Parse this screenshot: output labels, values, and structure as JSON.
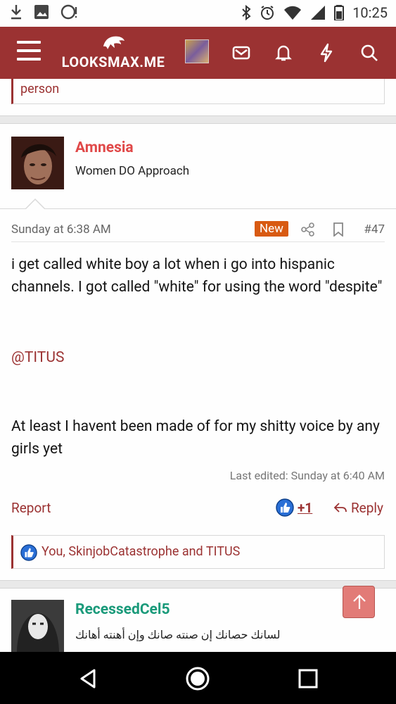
{
  "status_bar": {
    "time": "10:25",
    "left_icons": [
      "download-icon",
      "image-icon",
      "alert-cloud-icon"
    ],
    "right_icons": [
      "bluetooth-icon",
      "alarm-icon",
      "wifi-icon",
      "signal-icon",
      "battery-icon"
    ]
  },
  "app_bar": {
    "site_name": "LOOKSMAX.ME",
    "icons": [
      "menu-icon",
      "avatar",
      "inbox-icon",
      "bell-icon",
      "lightning-icon",
      "search-icon"
    ],
    "color": "#9b3232"
  },
  "previous_post": {
    "reaction_text": "person"
  },
  "post": {
    "username": "Amnesia",
    "user_title": "Women DO Approach",
    "date": "Sunday at 6:38 AM",
    "badge": "New",
    "number": "#47",
    "paragraphs": [
      "i get called white boy a lot when i go into hispanic channels. I got called \"white\" for using the word \"despite\"",
      "@TITUS",
      "At least I havent been made of for my shitty voice by any girls yet"
    ],
    "last_edited": "Last edited: Sunday at 6:40 AM",
    "actions": {
      "report": "Report",
      "like_count": "+1",
      "reply": "Reply"
    },
    "reactions_text": "You, SkinjobCatastrophe and TITUS"
  },
  "next_post": {
    "username": "RecessedCel5",
    "user_title": "لسانك حصانك إن صنته صانك وإن أهنته أهانك"
  },
  "colors": {
    "accent": "#9b3232",
    "username_red": "#e04848",
    "username_teal": "#1a9a7a",
    "new_badge": "#d85a12"
  }
}
